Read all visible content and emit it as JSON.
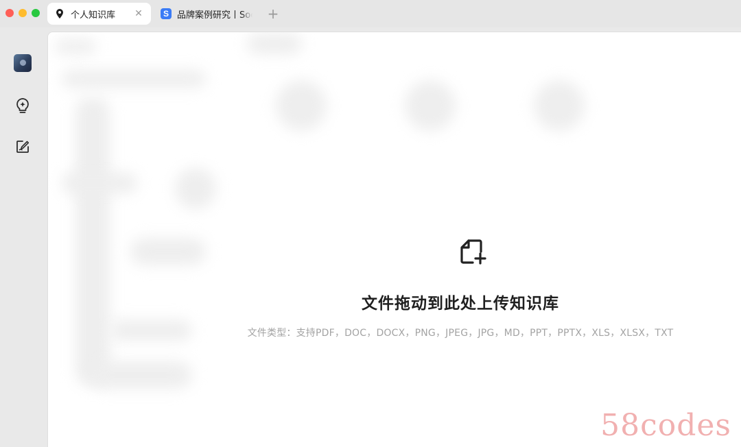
{
  "tabs": [
    {
      "label": "个人知识库",
      "close": "✕",
      "active": true,
      "icon": "map-pin-icon"
    },
    {
      "label": "品牌案例研究丨Soc",
      "active": false,
      "icon": "s-logo-icon"
    }
  ],
  "new_tab_symbol": "+",
  "rail": {
    "items": [
      {
        "name": "avatar"
      },
      {
        "icon": "sparkle-bulb-icon"
      },
      {
        "icon": "edit-note-icon"
      }
    ]
  },
  "dropzone": {
    "title": "文件拖动到此处上传知识库",
    "types": "文件类型：支持PDF，DOC，DOCX，PNG，JPEG，JPG，MD，PPT，PPTX，XLS，XLSX，TXT",
    "icon": "file-add-icon"
  },
  "logo_icon_letter": "S",
  "watermark": "58codes",
  "colors": {
    "traffic_red": "#ff5f57",
    "traffic_yellow": "#febc2e",
    "traffic_green": "#28c840",
    "tab_logo": "#3a7bf6",
    "watermark": "#f1b0b0"
  }
}
